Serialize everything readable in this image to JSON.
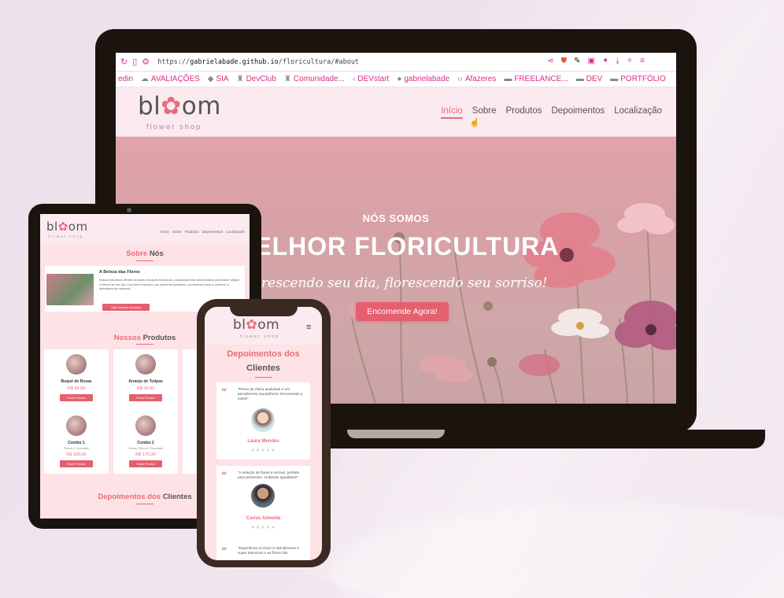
{
  "laptop": {
    "browser": {
      "url_prefix": "https://",
      "url_host": "gabrielabade.github.io",
      "url_path": "/floricultura/#about",
      "bookmarks": [
        {
          "icon": "linkedin-icon",
          "label": "edin"
        },
        {
          "icon": "cloud-icon",
          "label": "AVALIAÇÕES"
        },
        {
          "icon": "diamond-icon",
          "label": "SIA"
        },
        {
          "icon": "community-icon",
          "label": "DevClub"
        },
        {
          "icon": "community-icon",
          "label": "Comunidade..."
        },
        {
          "icon": "chevron-left-icon",
          "label": "DEVstart"
        },
        {
          "icon": "github-icon",
          "label": "gabrielabade"
        },
        {
          "icon": "code-icon",
          "label": "Afazeres"
        },
        {
          "icon": "folder-icon",
          "label": "FREELANCE..."
        },
        {
          "icon": "folder-icon",
          "label": "DEV"
        },
        {
          "icon": "folder-icon",
          "label": "PORTFÓLIO"
        }
      ]
    },
    "site": {
      "logo_start": "bl",
      "logo_end": "om",
      "logo_sub": "flower shop",
      "nav": [
        {
          "label": "Início",
          "active": true
        },
        {
          "label": "Sobre",
          "active": false
        },
        {
          "label": "Produtos",
          "active": false
        },
        {
          "label": "Depoimentos",
          "active": false
        },
        {
          "label": "Localização",
          "active": false
        }
      ],
      "hero": {
        "kicker": "NÓS SOMOS",
        "headline": "MELHOR FLORICULTURA",
        "tagline": "florescendo seu dia, florescendo seu sorriso!",
        "cta": "Encomende Agora!"
      }
    }
  },
  "tablet": {
    "nav": [
      "Início",
      "Sobre",
      "Produtos",
      "Depoimentos",
      "Localização"
    ],
    "about": {
      "title_a": "Sobre",
      "title_b": "Nós",
      "heading": "A Beleza das Flores",
      "text": "Nossa floricultura oferece arranjos e buquês exclusivos, cuidadosamente selecionados para trazer alegria e beleza ao seu dia. Com flores frescas e um ambiente acolhedor, convidamos você a conhecer a delicadeza da natureza.",
      "button": "Veja Nossos Arranjos"
    },
    "products": {
      "title_a": "Nossos",
      "title_b": "Produtos",
      "items": [
        {
          "name": "Buquê de Rosas",
          "desc": "",
          "price": "R$ 49,99",
          "button": "Fazer Pedido"
        },
        {
          "name": "Arranjo de Tulipas",
          "desc": "",
          "price": "R$ 59,99",
          "button": "Fazer Pedido"
        },
        {
          "name": "Combo 1",
          "desc": "Flores e Chocolate",
          "price": "R$ 109,99",
          "button": "Fazer Pedido"
        },
        {
          "name": "Combo 2",
          "desc": "Flores, Vinho e Chocolate",
          "price": "R$ 179,39",
          "button": "Fazer Pedido"
        }
      ]
    },
    "testimonials": {
      "title_a": "Depoimentos dos",
      "title_b": "Clientes"
    }
  },
  "phone": {
    "logo_start": "bl",
    "logo_end": "om",
    "logo_sub": "flower shop",
    "menu_icon": "hamburger-menu-icon",
    "section_title_a": "Depoimentos dos",
    "section_title_b": "Clientes",
    "testimonials": [
      {
        "text": "\"Flores de ótima qualidade e um atendimento maravilhoso! Recomendo a todos!\"",
        "name": "Laura Mendes",
        "stars": "★★★★★"
      },
      {
        "text": "\"A seleção de flores é incrível, perfeita para presentes. Ambiente agradável!\"",
        "name": "Carlos Almeida",
        "stars": "★★★★★"
      },
      {
        "text": "\"Experiência incrível! O atendimento é super atencioso e as flores são",
        "name": "",
        "stars": ""
      }
    ]
  },
  "colors": {
    "accent": "#e76e7b",
    "button": "#e55f6e",
    "page_bg": "#fde2e6",
    "device_frame": "#1a130e"
  }
}
